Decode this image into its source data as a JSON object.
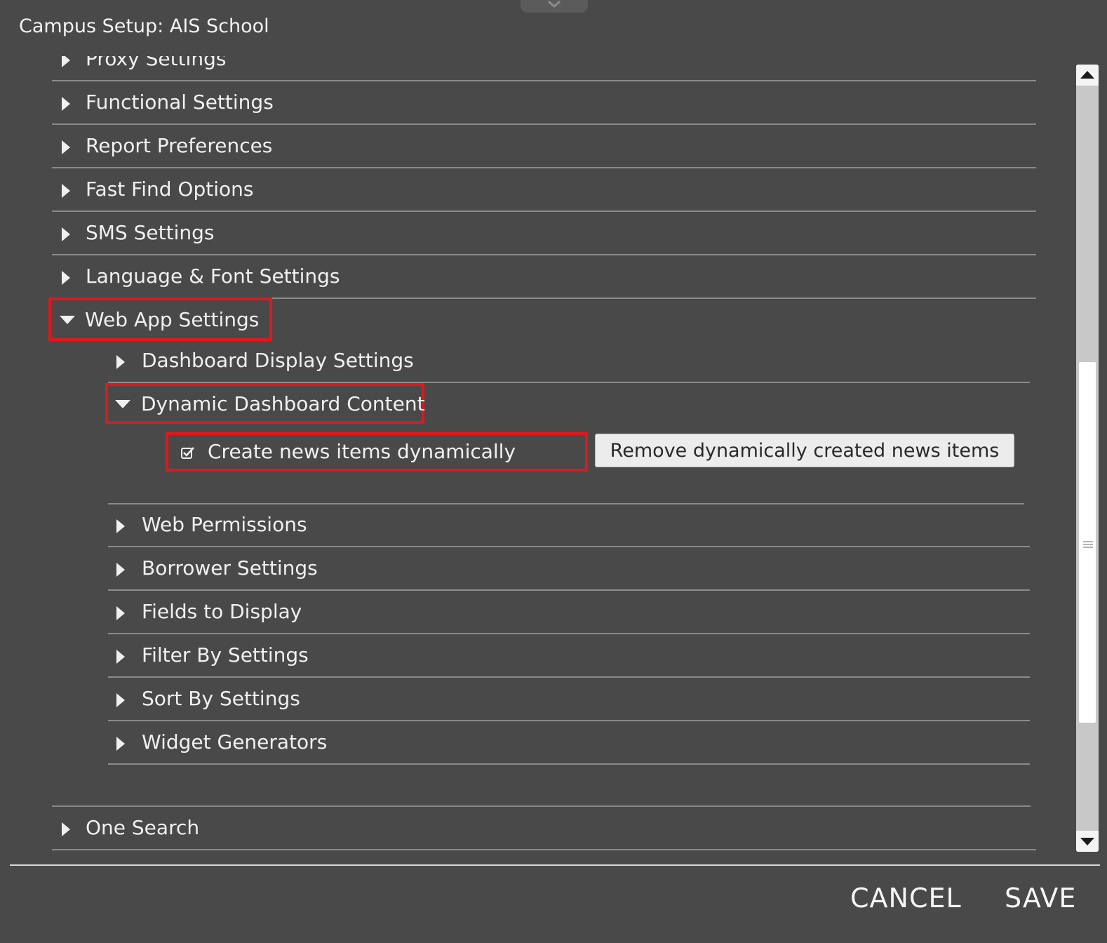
{
  "dialog": {
    "title": "Campus Setup: AIS School"
  },
  "tree": {
    "partial_item": "Proxy Settings",
    "top_items": [
      {
        "label": "Functional Settings",
        "expanded": false
      },
      {
        "label": "Report Preferences",
        "expanded": false
      },
      {
        "label": "Fast Find Options",
        "expanded": false
      },
      {
        "label": "SMS Settings",
        "expanded": false
      },
      {
        "label": "Language & Font Settings",
        "expanded": false
      }
    ],
    "web_app": {
      "label": "Web App Settings",
      "expanded": true,
      "children": [
        {
          "label": "Dashboard Display Settings",
          "expanded": false
        },
        {
          "label": "Dynamic Dashboard Content",
          "expanded": true
        },
        {
          "label": "Web Permissions",
          "expanded": false
        },
        {
          "label": "Borrower Settings",
          "expanded": false
        },
        {
          "label": "Fields to Display",
          "expanded": false
        },
        {
          "label": "Filter By Settings",
          "expanded": false
        },
        {
          "label": "Sort By Settings",
          "expanded": false
        },
        {
          "label": "Widget Generators",
          "expanded": false
        }
      ],
      "dynamic_content": {
        "checkbox_label": "Create news items dynamically",
        "checkbox_checked": true,
        "remove_button": "Remove dynamically created news items"
      }
    },
    "bottom_items": [
      {
        "label": "One Search",
        "expanded": false
      }
    ]
  },
  "footer": {
    "cancel": "CANCEL",
    "save": "SAVE"
  },
  "colors": {
    "background": "#4a494a",
    "highlight": "#e0181c",
    "text": "#f0f0f0"
  }
}
